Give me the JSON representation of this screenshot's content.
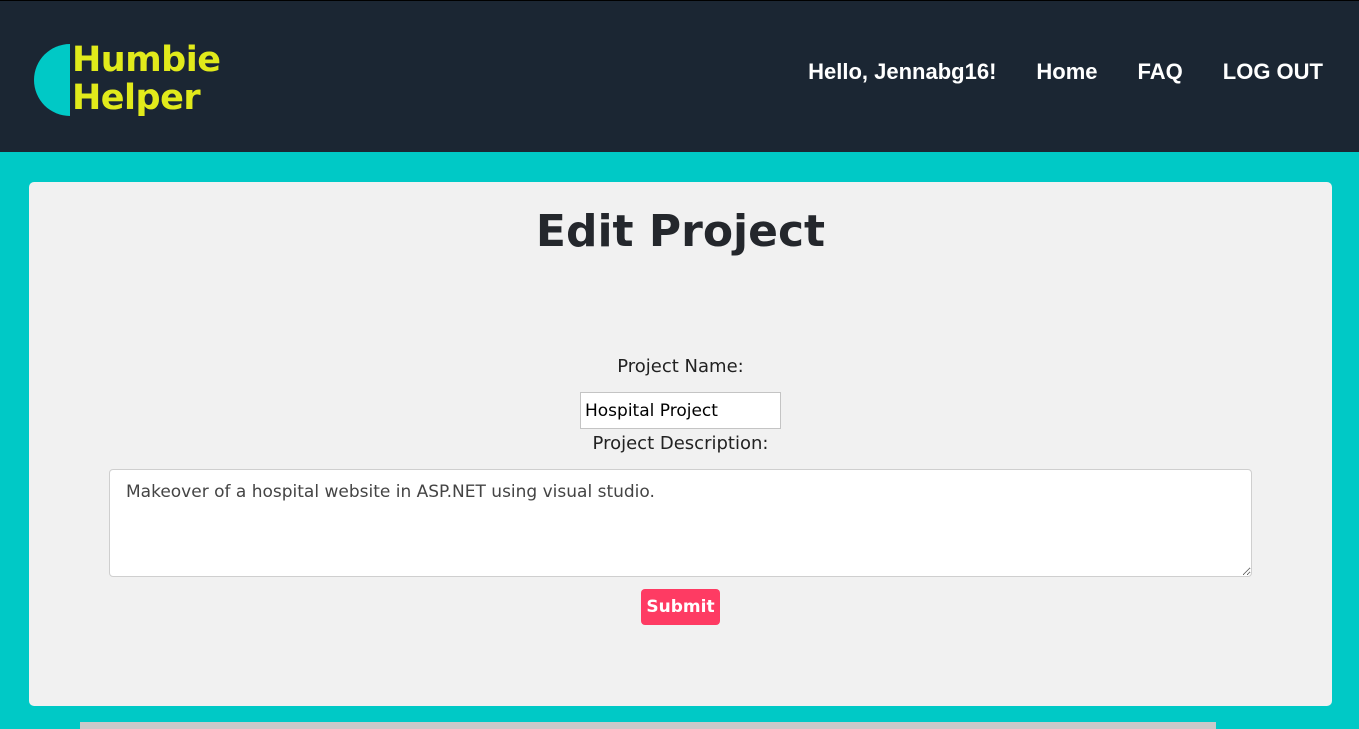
{
  "brand": {
    "line1": "Humbie",
    "line2": "Helper"
  },
  "nav": {
    "greeting": "Hello, Jennabg16!",
    "home": "Home",
    "faq": "FAQ",
    "logout": "LOG OUT"
  },
  "form": {
    "title": "Edit Project",
    "name_label": "Project Name:",
    "name_value": "Hospital Project",
    "description_label": "Project Description:",
    "description_value": "Makeover of a hospital website in ASP.NET using visual studio.",
    "submit_label": "Submit"
  },
  "colors": {
    "navbar_bg": "#1b2633",
    "page_bg": "#00c9c6",
    "logo_text": "#e1ea1b",
    "panel_bg": "#f1f1f1",
    "submit_bg": "#fe3b63"
  }
}
